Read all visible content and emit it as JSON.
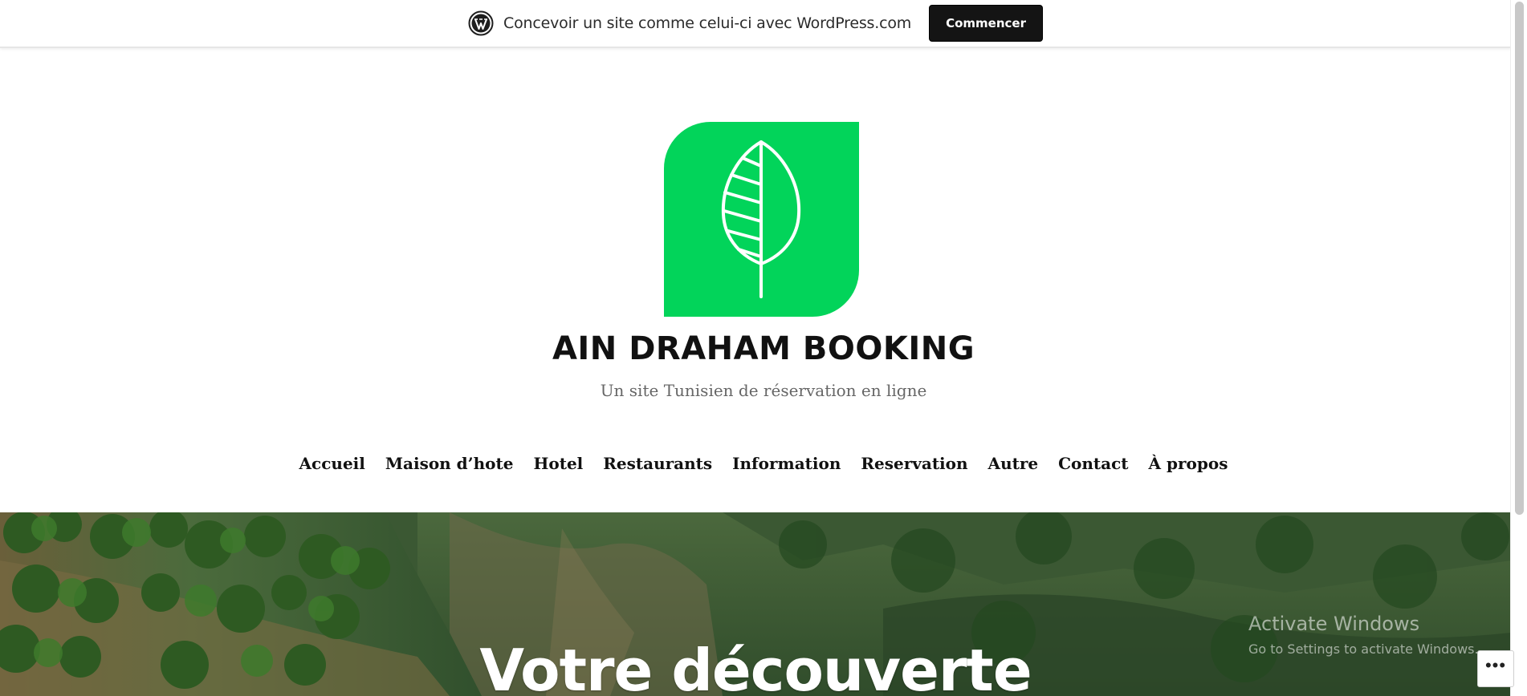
{
  "banner": {
    "text": "Concevoir un site comme celui-ci avec WordPress.com",
    "button_label": "Commencer",
    "logo_icon": "wordpress-logo-icon"
  },
  "header": {
    "logo_icon": "leaf-icon",
    "logo_color": "#02d45a",
    "title": "AIN DRAHAM BOOKING",
    "tagline": "Un site Tunisien de réservation en ligne"
  },
  "nav": {
    "items": [
      {
        "label": "Accueil"
      },
      {
        "label": "Maison d’hote"
      },
      {
        "label": "Hotel"
      },
      {
        "label": "Restaurants"
      },
      {
        "label": "Information"
      },
      {
        "label": "Reservation"
      },
      {
        "label": "Autre"
      },
      {
        "label": "Contact"
      },
      {
        "label": "À propos"
      }
    ]
  },
  "hero": {
    "title": "Votre découverte"
  },
  "watermark": {
    "line1": "Activate Windows",
    "line2": "Go to Settings to activate Windows."
  },
  "more_button": {
    "icon": "ellipsis-icon",
    "label": "•••"
  }
}
